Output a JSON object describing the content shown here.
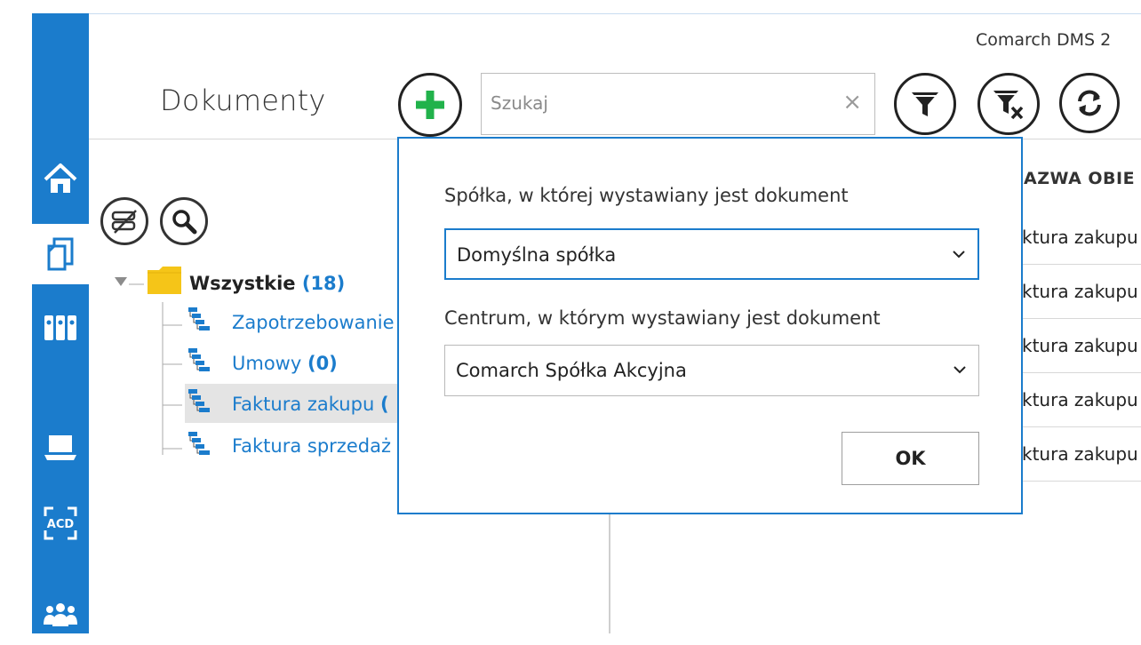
{
  "app": {
    "title": "Comarch DMS 2"
  },
  "header": {
    "page_title": "Dokumenty",
    "search": {
      "placeholder": "Szukaj",
      "value": "",
      "clear_symbol": "×"
    }
  },
  "sidebar": {
    "items": [
      {
        "icon": "home-icon"
      },
      {
        "icon": "documents-icon",
        "active": true
      },
      {
        "icon": "binders-icon"
      },
      {
        "icon": "laptop-icon"
      },
      {
        "icon": "acd-icon",
        "label": "ACD"
      },
      {
        "icon": "users-icon"
      }
    ]
  },
  "tree": {
    "root": {
      "label": "Wszystkie",
      "count": "(18)"
    },
    "children": [
      {
        "label": "Zapotrzebowanie",
        "count": ""
      },
      {
        "label": "Umowy",
        "count": "(0)"
      },
      {
        "label": "Faktura zakupu",
        "count": "(",
        "selected": true
      },
      {
        "label": "Faktura sprzedaż",
        "count": ""
      }
    ]
  },
  "list": {
    "header": "AZWA OBIE",
    "rows": [
      "ktura zakupu",
      "ktura zakupu",
      "ktura zakupu",
      "ktura zakupu",
      "ktura zakupu"
    ]
  },
  "dialog": {
    "company_label": "Spółka, w której wystawiany jest dokument",
    "company_value": "Domyślna spółka",
    "center_label": "Centrum, w którym wystawiany jest dokument",
    "center_value": "Comarch Spółka Akcyjna",
    "ok_label": "OK"
  },
  "colors": {
    "accent": "#1b7ccc",
    "add_green": "#21b24b",
    "folder": "#f5c518"
  }
}
